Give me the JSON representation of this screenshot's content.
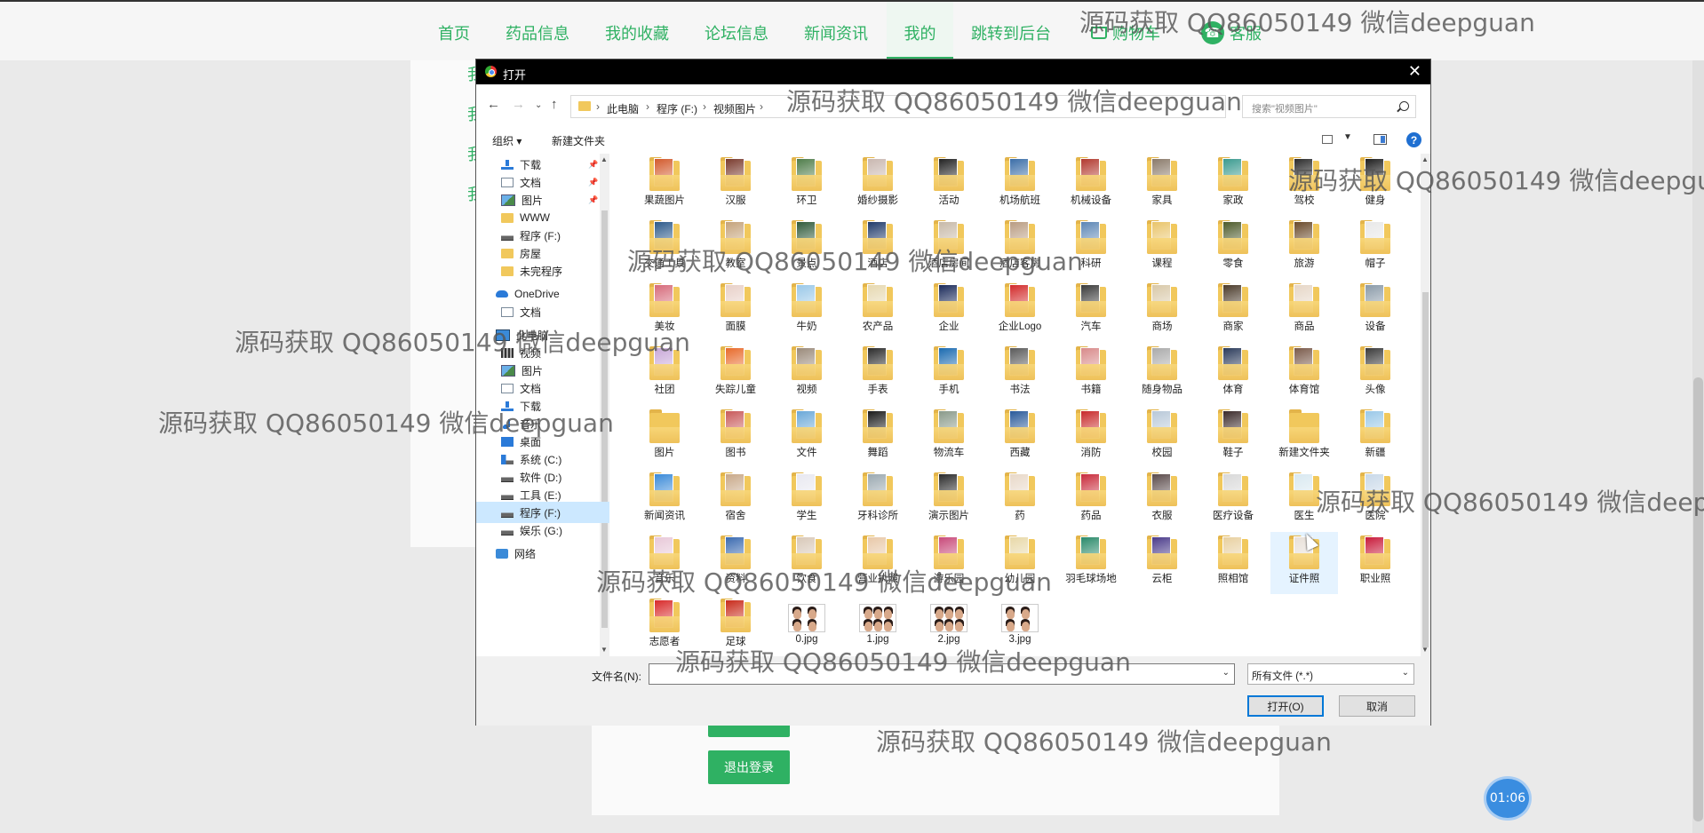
{
  "site": {
    "nav": [
      {
        "label": "首页"
      },
      {
        "label": "药品信息"
      },
      {
        "label": "我的收藏"
      },
      {
        "label": "论坛信息"
      },
      {
        "label": "新闻资讯"
      },
      {
        "label": "我的"
      },
      {
        "label": "跳转到后台"
      }
    ],
    "cart_label": "购物车",
    "service_label": "客服",
    "side_links": [
      "我",
      "我",
      "我",
      "我"
    ],
    "logout_label": "退出登录",
    "timer": "01:06",
    "accent": "#2fb163"
  },
  "dialog": {
    "title": "打开",
    "breadcrumb": [
      "此电脑",
      "程序 (F:)",
      "视频图片"
    ],
    "search_placeholder": "搜索\"视频图片\"",
    "organize_label": "组织 ▾",
    "new_folder_label": "新建文件夹",
    "help_label": "?",
    "nav_pane": [
      {
        "label": "下载",
        "icon": "download-arrow-icon",
        "pinned": true
      },
      {
        "label": "文档",
        "icon": "document-icon",
        "pinned": true
      },
      {
        "label": "图片",
        "icon": "pictures-icon",
        "pinned": true
      },
      {
        "label": "WWW",
        "icon": "folder-icon"
      },
      {
        "label": "程序 (F:)",
        "icon": "drive-icon"
      },
      {
        "label": "房屋",
        "icon": "folder-icon"
      },
      {
        "label": "未完程序",
        "icon": "folder-icon"
      },
      {
        "label": "OneDrive",
        "icon": "onedrive-cloud-icon"
      },
      {
        "label": "文档",
        "icon": "document-icon"
      },
      {
        "label": "此电脑",
        "icon": "computer-icon"
      },
      {
        "label": "视频",
        "icon": "video-icon"
      },
      {
        "label": "图片",
        "icon": "pictures-icon"
      },
      {
        "label": "文档",
        "icon": "document-icon"
      },
      {
        "label": "下载",
        "icon": "download-arrow-icon"
      },
      {
        "label": "音乐",
        "icon": "music-note-icon"
      },
      {
        "label": "桌面",
        "icon": "desktop-icon"
      },
      {
        "label": "系统 (C:)",
        "icon": "windows-drive-icon"
      },
      {
        "label": "软件 (D:)",
        "icon": "drive-icon"
      },
      {
        "label": "工具 (E:)",
        "icon": "drive-icon"
      },
      {
        "label": "程序 (F:)",
        "icon": "drive-icon",
        "selected": true
      },
      {
        "label": "娱乐 (G:)",
        "icon": "drive-icon"
      },
      {
        "label": "网络",
        "icon": "network-icon"
      }
    ],
    "files": [
      {
        "label": "果蔬图片",
        "type": "folder",
        "color": "#d25a2c"
      },
      {
        "label": "汉服",
        "type": "folder",
        "color": "#7a3b2e"
      },
      {
        "label": "环卫",
        "type": "folder",
        "color": "#4f7d4a"
      },
      {
        "label": "婚纱摄影",
        "type": "folder",
        "color": "#c9b7b0"
      },
      {
        "label": "活动",
        "type": "folder",
        "color": "#222222"
      },
      {
        "label": "机场航班",
        "type": "folder",
        "color": "#3b6ea8"
      },
      {
        "label": "机械设备",
        "type": "folder",
        "color": "#b23a2f"
      },
      {
        "label": "家具",
        "type": "folder",
        "color": "#8a7a6a"
      },
      {
        "label": "家政",
        "type": "folder",
        "color": "#3a9a8f"
      },
      {
        "label": "驾校",
        "type": "folder",
        "color": "#2b2b2b"
      },
      {
        "label": "健身",
        "type": "folder",
        "color": "#1e1e1e"
      },
      {
        "label": "交通工具",
        "type": "folder",
        "color": "#2d5a8a"
      },
      {
        "label": "教室",
        "type": "folder",
        "color": "#c4a27a"
      },
      {
        "label": "景点",
        "type": "folder",
        "color": "#2f5a3a"
      },
      {
        "label": "酒店",
        "type": "folder",
        "color": "#1f3a6a"
      },
      {
        "label": "酒店房间",
        "type": "folder",
        "color": "#c7b9a8"
      },
      {
        "label": "酒店客房",
        "type": "folder",
        "color": "#b99c82"
      },
      {
        "label": "科研",
        "type": "folder",
        "color": "#5c86b5"
      },
      {
        "label": "课程",
        "type": "folder",
        "color": "#e9c46a"
      },
      {
        "label": "零食",
        "type": "folder",
        "color": "#4d5a2a"
      },
      {
        "label": "旅游",
        "type": "folder",
        "color": "#6a4a2a"
      },
      {
        "label": "帽子",
        "type": "folder",
        "color": "#e8e8e8"
      },
      {
        "label": "美妆",
        "type": "folder",
        "color": "#d66a7a"
      },
      {
        "label": "面膜",
        "type": "folder",
        "color": "#e8d0c8"
      },
      {
        "label": "牛奶",
        "type": "folder",
        "color": "#9ac8e8"
      },
      {
        "label": "农产品",
        "type": "folder",
        "color": "#e6d8b0"
      },
      {
        "label": "企业",
        "type": "folder",
        "color": "#1a2a5a"
      },
      {
        "label": "企业Logo",
        "type": "folder",
        "color": "#d22a2a"
      },
      {
        "label": "汽车",
        "type": "folder",
        "color": "#3a3a3a"
      },
      {
        "label": "商场",
        "type": "folder",
        "color": "#d8c8a8"
      },
      {
        "label": "商家",
        "type": "folder",
        "color": "#4a3a2a"
      },
      {
        "label": "商品",
        "type": "folder",
        "color": "#e6d6c6"
      },
      {
        "label": "设备",
        "type": "folder",
        "color": "#8a9aa8"
      },
      {
        "label": "社团",
        "type": "folder",
        "color": "#c8a8d8"
      },
      {
        "label": "失踪儿童",
        "type": "folder",
        "color": "#e86a2a"
      },
      {
        "label": "视频",
        "type": "folder",
        "color": "#9a8a7a"
      },
      {
        "label": "手表",
        "type": "folder",
        "color": "#2a2a2a"
      },
      {
        "label": "手机",
        "type": "folder",
        "color": "#1a6ab0"
      },
      {
        "label": "书法",
        "type": "folder",
        "color": "#5a5a5a"
      },
      {
        "label": "书籍",
        "type": "folder",
        "color": "#d88a8a"
      },
      {
        "label": "随身物品",
        "type": "folder",
        "color": "#aaaaaa"
      },
      {
        "label": "体育",
        "type": "folder",
        "color": "#2a3a5a"
      },
      {
        "label": "体育馆",
        "type": "folder",
        "color": "#7a5a4a"
      },
      {
        "label": "头像",
        "type": "folder",
        "color": "#3a3a3a"
      },
      {
        "label": "图片",
        "type": "folder",
        "color": ""
      },
      {
        "label": "图书",
        "type": "folder",
        "color": "#c85a5a"
      },
      {
        "label": "文件",
        "type": "folder",
        "color": "#6aa8d8"
      },
      {
        "label": "舞蹈",
        "type": "folder",
        "color": "#1a1a1a"
      },
      {
        "label": "物流车",
        "type": "folder",
        "color": "#8a9a8a"
      },
      {
        "label": "西藏",
        "type": "folder",
        "color": "#2a5a9a"
      },
      {
        "label": "消防",
        "type": "folder",
        "color": "#c82a2a"
      },
      {
        "label": "校园",
        "type": "folder",
        "color": "#b8c8d8"
      },
      {
        "label": "鞋子",
        "type": "folder",
        "color": "#3a2a2a"
      },
      {
        "label": "新建文件夹",
        "type": "folder",
        "color": ""
      },
      {
        "label": "新疆",
        "type": "folder",
        "color": "#9ac8e8"
      },
      {
        "label": "新闻资讯",
        "type": "folder",
        "color": "#3a8ad8"
      },
      {
        "label": "宿舍",
        "type": "folder",
        "color": "#c8a888"
      },
      {
        "label": "学生",
        "type": "folder",
        "color": "#e8e8f0"
      },
      {
        "label": "牙科诊所",
        "type": "folder",
        "color": "#9aa8b0"
      },
      {
        "label": "演示图片",
        "type": "folder",
        "color": "#2a2a2a"
      },
      {
        "label": "药",
        "type": "folder",
        "color": "#e8d8c8"
      },
      {
        "label": "药品",
        "type": "folder",
        "color": "#c82a3a"
      },
      {
        "label": "衣服",
        "type": "folder",
        "color": "#5a4a4a"
      },
      {
        "label": "医疗设备",
        "type": "folder",
        "color": "#d8d8d8"
      },
      {
        "label": "医生",
        "type": "folder",
        "color": "#d8e8f0"
      },
      {
        "label": "医院",
        "type": "folder",
        "color": "#c8d8e8"
      },
      {
        "label": "音乐",
        "type": "folder",
        "color": "#e8c8d8"
      },
      {
        "label": "资料",
        "type": "folder",
        "color": "#3a6ab0"
      },
      {
        "label": "饮食",
        "type": "folder",
        "color": "#d8c8b8"
      },
      {
        "label": "营业执照",
        "type": "folder",
        "color": "#e8c8a8"
      },
      {
        "label": "游乐园",
        "type": "folder",
        "color": "#c84a7a"
      },
      {
        "label": "幼儿园",
        "type": "folder",
        "color": "#e8d8a8"
      },
      {
        "label": "羽毛球场地",
        "type": "folder",
        "color": "#2a8a6a"
      },
      {
        "label": "云柜",
        "type": "folder",
        "color": "#4a3a8a"
      },
      {
        "label": "照相馆",
        "type": "folder",
        "color": "#e8d0a0"
      },
      {
        "label": "证件照",
        "type": "folder",
        "color": "#e8e0d8",
        "hover": true
      },
      {
        "label": "职业照",
        "type": "folder",
        "color": "#c81a3a"
      },
      {
        "label": "志愿者",
        "type": "folder",
        "color": "#d82a2a"
      },
      {
        "label": "足球",
        "type": "folder",
        "color": "#c82a1a"
      },
      {
        "label": "0.jpg",
        "type": "jpg",
        "faces": 2
      },
      {
        "label": "1.jpg",
        "type": "jpg",
        "faces": 3
      },
      {
        "label": "2.jpg",
        "type": "jpg",
        "faces": 3
      },
      {
        "label": "3.jpg",
        "type": "jpg",
        "faces": 2
      }
    ],
    "filename_label": "文件名(N):",
    "filename_value": "",
    "filetype_value": "所有文件 (*.*)",
    "open_label": "打开(O)",
    "cancel_label": "取消",
    "accent": "#0078d7"
  },
  "watermark": "源码获取 QQ86050149 微信deepguan"
}
